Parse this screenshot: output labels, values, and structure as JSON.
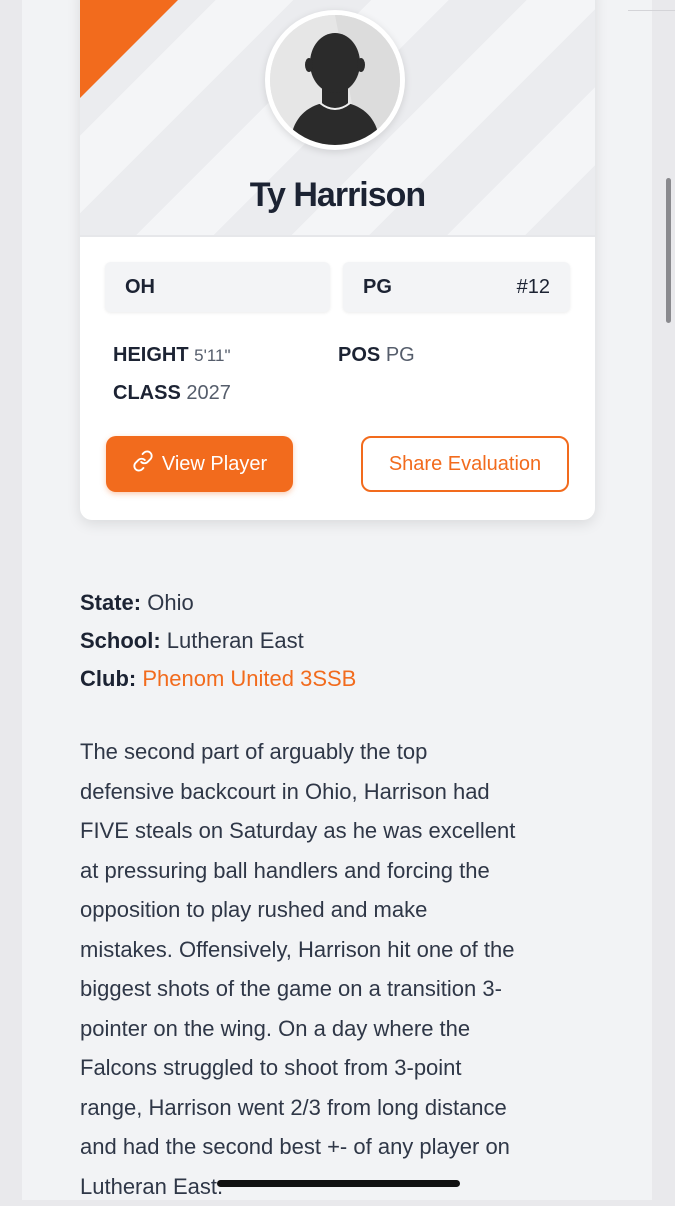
{
  "player": {
    "name": "Ty Harrison",
    "state_chip": "OH",
    "position_chip": "PG",
    "jersey": "#12"
  },
  "stats": {
    "height_label": "HEIGHT",
    "height_value": "5'11\"",
    "class_label": "CLASS",
    "class_value": "2027",
    "pos_label": "POS",
    "pos_value": "PG"
  },
  "buttons": {
    "view_player": "View Player",
    "share_evaluation": "Share Evaluation"
  },
  "info": {
    "state_label": "State:",
    "state_value": "Ohio",
    "school_label": "School:",
    "school_value": "Lutheran East",
    "club_label": "Club:",
    "club_value": "Phenom United 3SSB"
  },
  "evaluation_lines": [
    "The second part of arguably the top",
    "defensive backcourt in Ohio, Harrison had",
    "FIVE steals on Saturday as he was excellent",
    "at pressuring ball handlers and forcing the",
    "opposition to play rushed and make",
    "mistakes. Offensively, Harrison hit one of the",
    "biggest shots of the game on a transition 3-",
    "pointer on the wing. On a day where the",
    "Falcons struggled to shoot from 3-point",
    "range, Harrison went 2/3 from long distance",
    "and had the second best +- of any player on",
    "Lutheran East."
  ],
  "colors": {
    "accent": "#f26b1d",
    "text_dark": "#1c2333",
    "background": "#f2f3f5"
  },
  "icons": {
    "avatar": "player-silhouette-icon",
    "view_player": "link-icon"
  }
}
